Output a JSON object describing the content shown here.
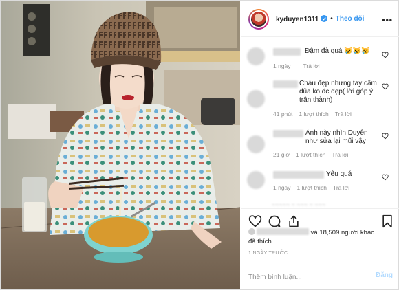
{
  "post": {
    "username": "kyduyen1311",
    "follow_label": "Theo dõi",
    "separator": "•",
    "more_label": "•••"
  },
  "comments": [
    {
      "text": "Đậm đà quá 😿😿😿",
      "time": "1 ngày",
      "likes": "",
      "reply": "Trả lời"
    },
    {
      "text": "Cháu đẹp nhưng tay cầm đũa ko đc đẹp( lời góp ý trân thành)",
      "time": "41 phút",
      "likes": "1 lượt thích",
      "reply": "Trả lời"
    },
    {
      "text": "Ảnh này nhìn Duyên như sửa lại mũi vậy",
      "time": "21 giờ",
      "likes": "1 lượt thích",
      "reply": "Trả lời"
    },
    {
      "text": "Yêu quá",
      "time": "1 ngày",
      "likes": "1 lượt thích",
      "reply": "Trả lời"
    }
  ],
  "likes": {
    "text": "và 18,509 người khác",
    "suffix": "đã thích"
  },
  "date": "1 NGÀY TRƯỚC",
  "add_comment": {
    "placeholder": "Thêm bình luận...",
    "post_label": "Đăng"
  },
  "icons": {
    "heart": "heart-icon",
    "comment": "comment-icon",
    "share": "share-icon",
    "bookmark": "bookmark-icon",
    "verified": "verified-badge-icon"
  },
  "colors": {
    "link_blue": "#3897f0",
    "post_disabled": "#b3dbff",
    "meta_gray": "#8e8e8e"
  }
}
